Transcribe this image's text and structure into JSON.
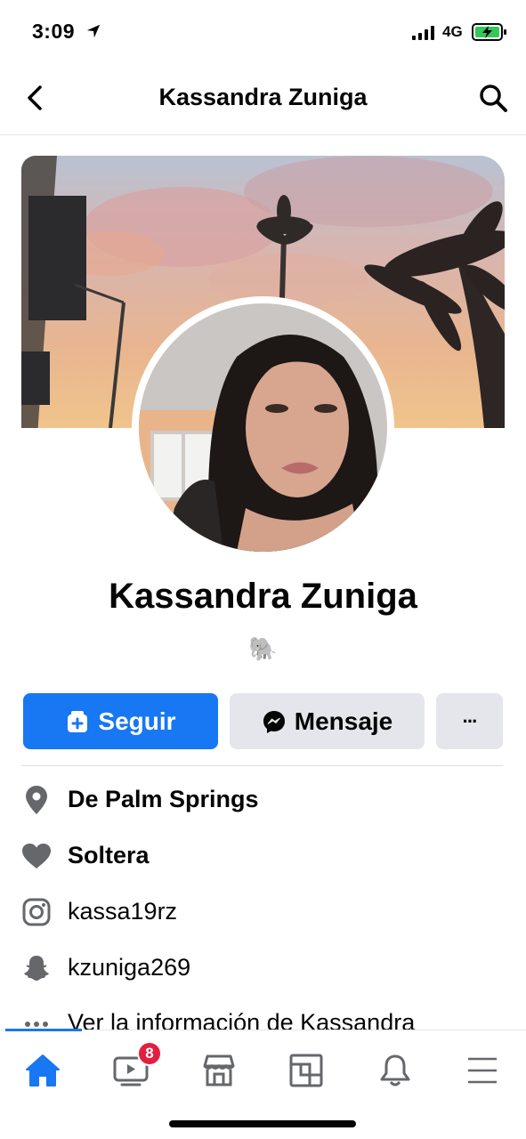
{
  "status_bar": {
    "time": "3:09",
    "network": "4G"
  },
  "header": {
    "title": "Kassandra Zuniga",
    "back_icon": "chevron-left-icon",
    "search_icon": "search-icon"
  },
  "profile": {
    "name": "Kassandra Zuniga",
    "bio": "🐘"
  },
  "actions": {
    "follow_label": "Seguir",
    "message_label": "Mensaje",
    "more_label": "···"
  },
  "info": [
    {
      "icon": "location-pin-icon",
      "text": "De Palm Springs"
    },
    {
      "icon": "heart-icon",
      "text": "Soltera"
    },
    {
      "icon": "instagram-icon",
      "text": "kassa19rz"
    },
    {
      "icon": "snapchat-icon",
      "text": "kzuniga269"
    },
    {
      "icon": "more-horizontal-icon",
      "text": "Ver la información de Kassandra"
    }
  ],
  "tab_bar": {
    "items": [
      "home-icon",
      "watch-icon",
      "marketplace-icon",
      "groups-icon",
      "notifications-icon",
      "menu-icon"
    ],
    "watch_badge": "8"
  },
  "colors": {
    "accent": "#1877f2",
    "badge": "#e41e3f",
    "secondary_button": "#e4e6eb"
  }
}
